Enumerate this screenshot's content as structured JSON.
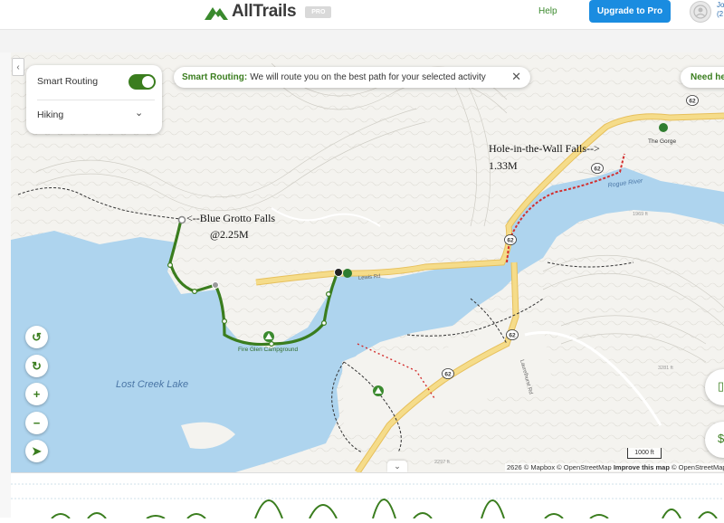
{
  "header": {
    "brand": "AllTrails",
    "badge": "PRO",
    "help": "Help",
    "upgrade": "Upgrade to Pro",
    "user_initials": "Jo",
    "user_fragment": "(2"
  },
  "routing_panel": {
    "smart_routing_label": "Smart Routing",
    "smart_routing_on": true,
    "activity": "Hiking"
  },
  "banner": {
    "title": "Smart Routing:",
    "message": "We will route you on the best path for your selected activity"
  },
  "need_help": "Need he",
  "map": {
    "lake_label": "Lost Creek Lake",
    "river_label": "Rogue River",
    "campground_label": "Fire Glen Campground",
    "poi_gorge": "The Gorge",
    "road_lewis": "Lewis Rd",
    "road_laurelhurst": "Laurelhurst Rd",
    "shield_62": "62",
    "elev_contour_a": "1969 ft",
    "elev_contour_b": "3281 ft",
    "elev_contour_c": "2297 ft",
    "annotation_blue_grotto_line1": "<--Blue Grotto Falls",
    "annotation_blue_grotto_line2": "@2.25M",
    "annotation_hole_line1": "Hole-in-the-Wall Falls-->",
    "annotation_hole_line2": "1.33M",
    "scale_label": "1000 ft",
    "attribution_a": "© Mapbox © OpenStreetMap",
    "attribution_improve": "Improve this map",
    "attribution_b": "© OpenStreetMap",
    "attribution_copy": "2626",
    "colors": {
      "water": "#aed4ee",
      "land": "#f4f3ef",
      "route": "#3a7d1e",
      "trail_red": "#d32f2f",
      "road": "#f3cf6a"
    }
  }
}
